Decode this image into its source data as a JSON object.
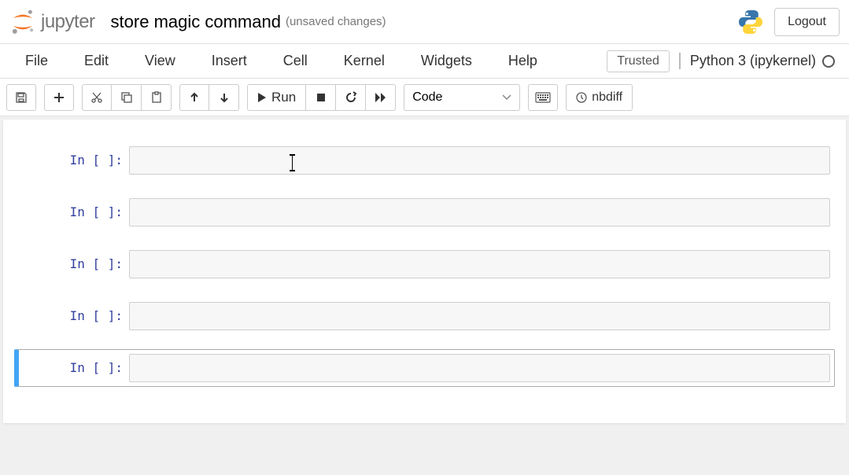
{
  "header": {
    "logo_text": "jupyter",
    "notebook_title": "store magic command",
    "save_status": "(unsaved changes)",
    "logout_label": "Logout"
  },
  "menubar": {
    "items": [
      "File",
      "Edit",
      "View",
      "Insert",
      "Cell",
      "Kernel",
      "Widgets",
      "Help"
    ],
    "trusted_label": "Trusted",
    "kernel_name": "Python 3 (ipykernel)"
  },
  "toolbar": {
    "run_label": "Run",
    "celltype_selected": "Code",
    "nbdiff_label": "nbdiff"
  },
  "cells": [
    {
      "prompt": "In [ ]:",
      "content": "",
      "selected": false,
      "has_cursor": true
    },
    {
      "prompt": "In [ ]:",
      "content": "",
      "selected": false,
      "has_cursor": false
    },
    {
      "prompt": "In [ ]:",
      "content": "",
      "selected": false,
      "has_cursor": false
    },
    {
      "prompt": "In [ ]:",
      "content": "",
      "selected": false,
      "has_cursor": false
    },
    {
      "prompt": "In [ ]:",
      "content": "",
      "selected": true,
      "has_cursor": false
    }
  ]
}
